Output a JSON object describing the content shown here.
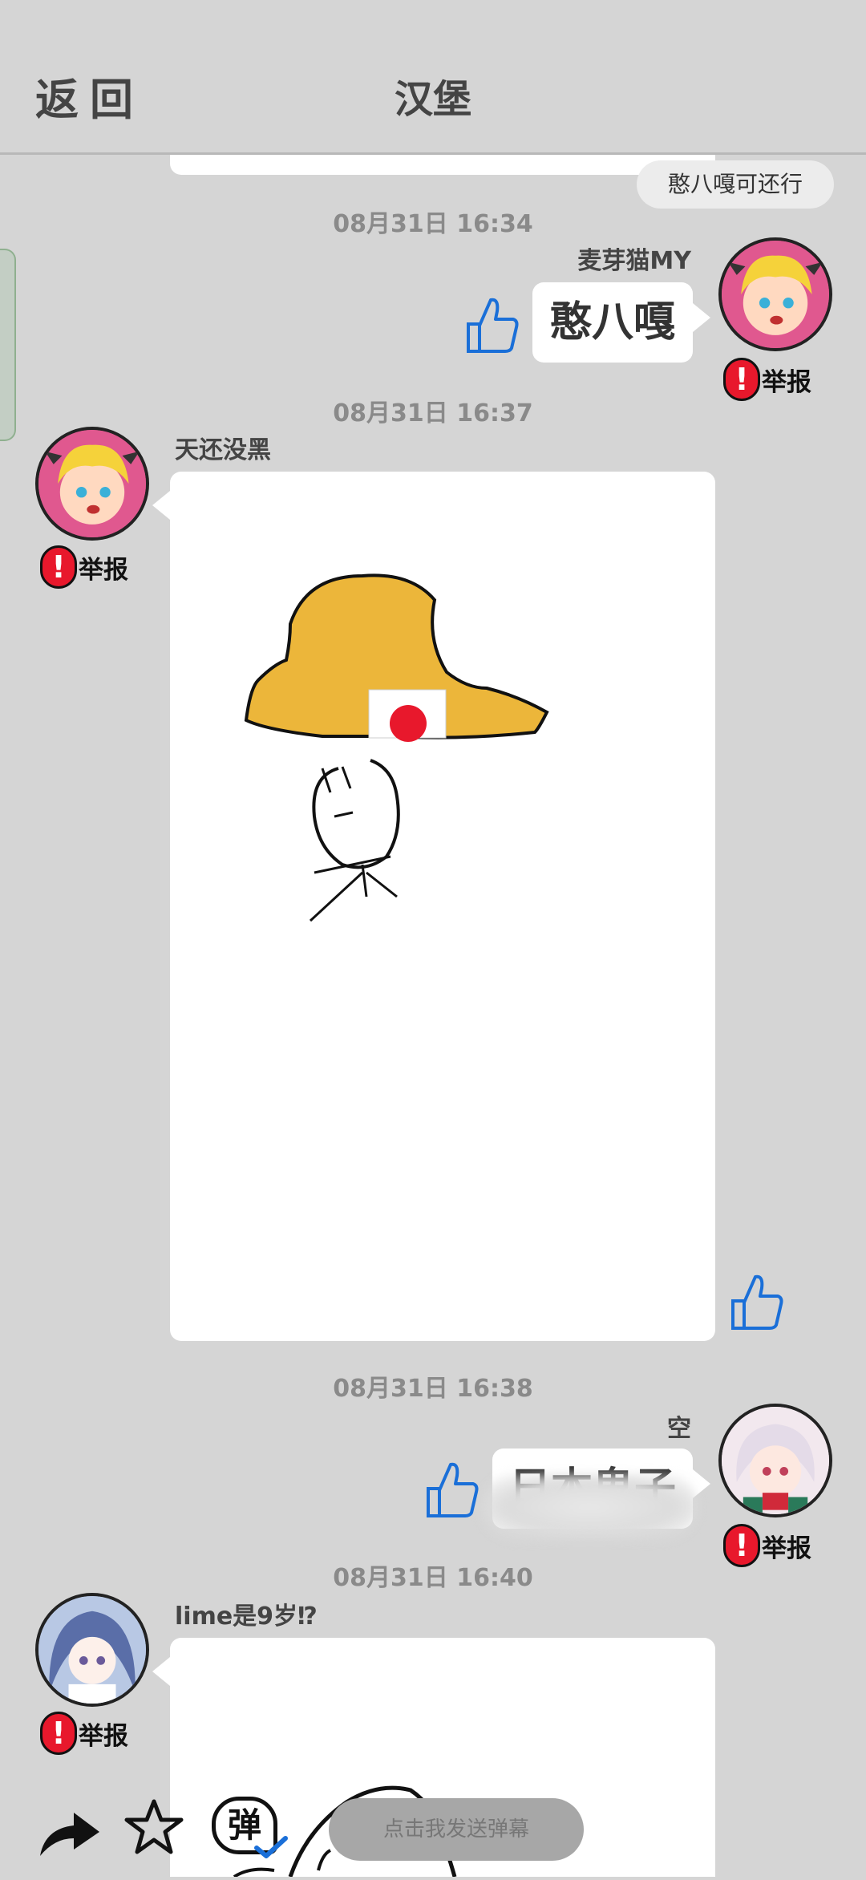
{
  "header": {
    "back_label": "返回",
    "title": "汉堡"
  },
  "danmaku_toast": "憨八嘎可还行",
  "messages": [
    {
      "timestamp": "08月31日 16:34",
      "user": "麦芽猫MY",
      "side": "right",
      "text": "憨八嘎",
      "report_label": "举报"
    },
    {
      "timestamp": "08月31日 16:37",
      "user": "天还没黑",
      "side": "left",
      "content": "drawing",
      "report_label": "举报"
    },
    {
      "timestamp": "08月31日 16:38",
      "user": "空",
      "side": "right",
      "text": "日本鬼子",
      "text_obscured": true,
      "report_label": "举报"
    },
    {
      "timestamp": "08月31日 16:40",
      "user": "lime是9岁⁉",
      "side": "left",
      "content": "drawing",
      "report_label": "举报"
    }
  ],
  "toolbar": {
    "icons": [
      "share-icon",
      "star-icon",
      "danmaku-toggle-icon"
    ],
    "danmaku_glyph": "弹",
    "danmaku_placeholder": "点击我发送弹幕"
  },
  "colors": {
    "background": "#d5d5d5",
    "report_red": "#e8182c",
    "like_blue": "#1a6fd8",
    "hat_yellow": "#ecb63a"
  }
}
